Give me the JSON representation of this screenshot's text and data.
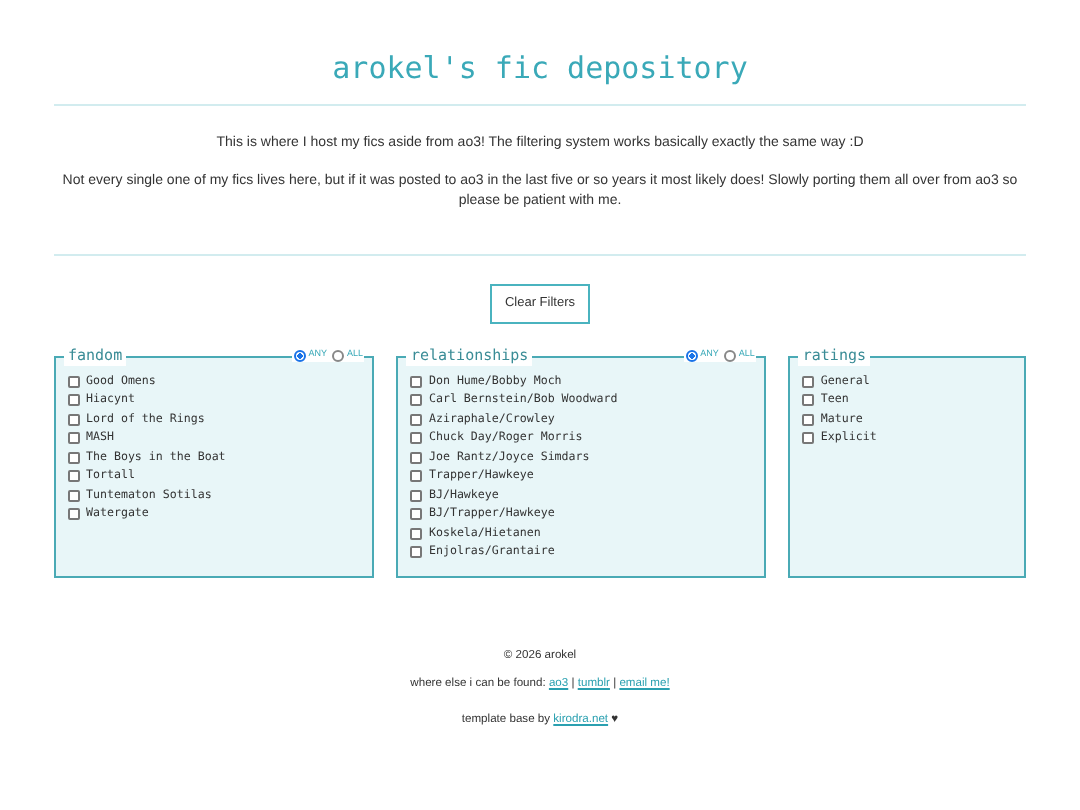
{
  "title": "arokel's fic depository",
  "intro": [
    "This is where I host my fics aside from ao3! The filtering system works basically exactly the same way :D",
    "Not every single one of my fics lives here, but if it was posted to ao3 in the last five or so years it most likely does! Slowly porting them all over from ao3 so please be patient with me."
  ],
  "clear_button": "Clear Filters",
  "filters": [
    {
      "legend": "fandom",
      "modes": [
        {
          "label": "ANY",
          "selected": true
        },
        {
          "label": "ALL",
          "selected": false
        }
      ],
      "items": [
        {
          "label": "Good Omens",
          "checked": false
        },
        {
          "label": "Hiacynt",
          "checked": false
        },
        {
          "label": "Lord of the Rings",
          "checked": false
        },
        {
          "label": "MASH",
          "checked": false
        },
        {
          "label": "The Boys in the Boat",
          "checked": false
        },
        {
          "label": "Tortall",
          "checked": false
        },
        {
          "label": "Tuntematon Sotilas",
          "checked": false
        },
        {
          "label": "Watergate",
          "checked": false
        }
      ]
    },
    {
      "legend": "relationships",
      "modes": [
        {
          "label": "ANY",
          "selected": true
        },
        {
          "label": "ALL",
          "selected": false
        }
      ],
      "items": [
        {
          "label": "Don Hume/Bobby Moch",
          "checked": false
        },
        {
          "label": "Carl Bernstein/Bob Woodward",
          "checked": false
        },
        {
          "label": "Aziraphale/Crowley",
          "checked": false
        },
        {
          "label": "Chuck Day/Roger Morris",
          "checked": false
        },
        {
          "label": "Joe Rantz/Joyce Simdars",
          "checked": false
        },
        {
          "label": "Trapper/Hawkeye",
          "checked": false
        },
        {
          "label": "BJ/Hawkeye",
          "checked": false
        },
        {
          "label": "BJ/Trapper/Hawkeye",
          "checked": false
        },
        {
          "label": "Koskela/Hietanen",
          "checked": false
        },
        {
          "label": "Enjolras/Grantaire",
          "checked": false
        }
      ]
    },
    {
      "legend": "ratings",
      "items": [
        {
          "label": "General",
          "checked": false
        },
        {
          "label": "Teen",
          "checked": false
        },
        {
          "label": "Mature",
          "checked": false
        },
        {
          "label": "Explicit",
          "checked": false
        }
      ]
    }
  ],
  "footer": {
    "copyright": "© 2026 arokel",
    "links_label": "where else i can be found:",
    "links": [
      "ao3",
      "tumblr",
      "email me!"
    ],
    "separator": "|",
    "credit_label": "template base by",
    "credit_link": "kirodra.net",
    "credit_heart": "♥"
  }
}
